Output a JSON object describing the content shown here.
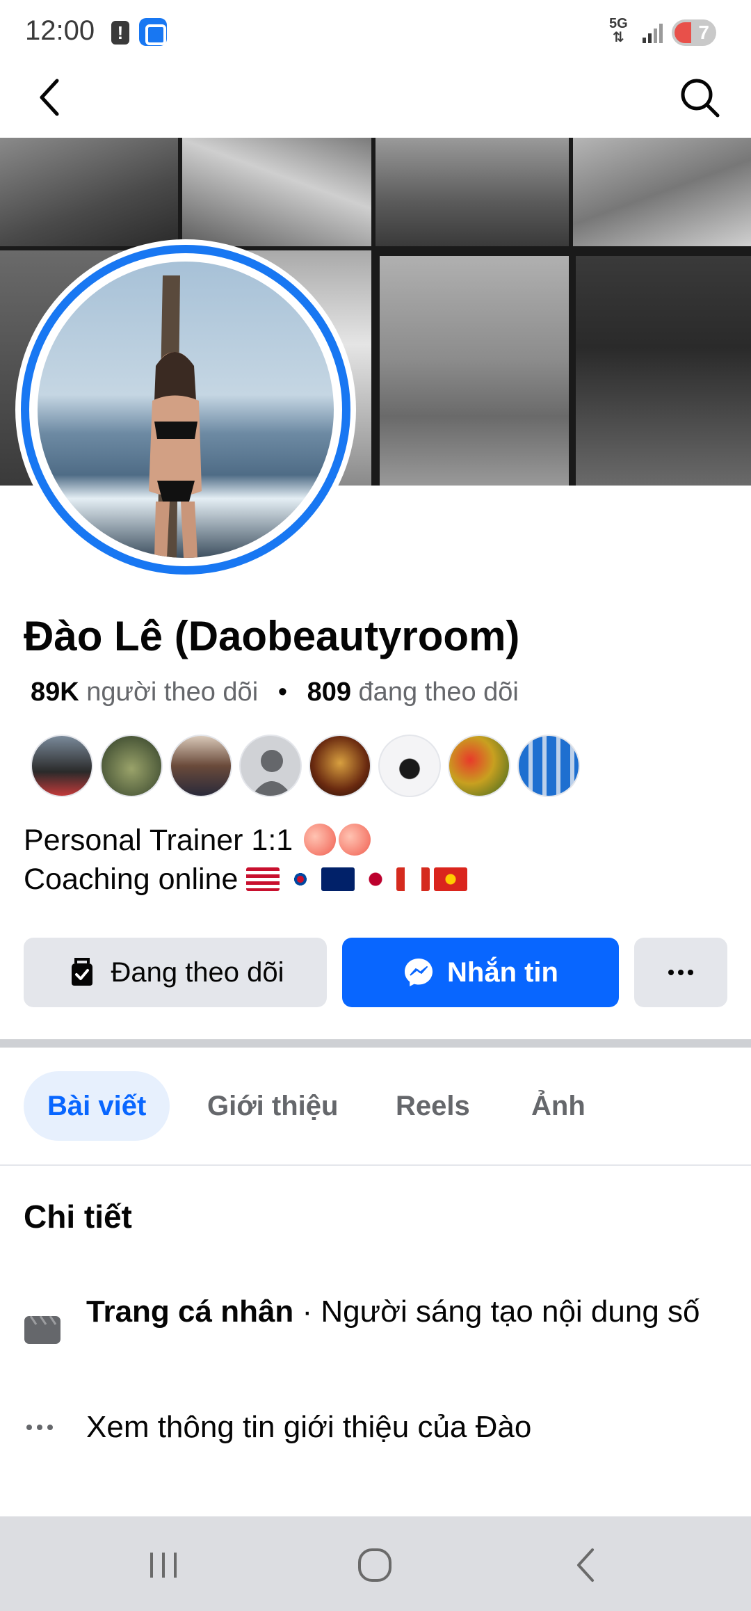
{
  "status_bar": {
    "time": "12:00",
    "network": "5G",
    "battery": "7"
  },
  "nav": {
    "back_icon": "chevron-left-icon",
    "search_icon": "search-icon"
  },
  "profile": {
    "name": "Đào Lê (Daobeautyroom)",
    "followers_count": "89K",
    "followers_label": "người theo dõi",
    "separator": "•",
    "following_count": "809",
    "following_label": "đang theo dõi",
    "bio_line1": "Personal Trainer 1:1",
    "bio_line2": "Coaching online"
  },
  "actions": {
    "following_label": "Đang theo dõi",
    "message_label": "Nhắn tin",
    "more_label": "..."
  },
  "tabs": [
    {
      "label": "Bài viết",
      "active": true
    },
    {
      "label": "Giới thiệu",
      "active": false
    },
    {
      "label": "Reels",
      "active": false
    },
    {
      "label": "Ảnh",
      "active": false
    }
  ],
  "details": {
    "title": "Chi tiết",
    "page_type_bold": "Trang cá nhân",
    "page_type_rest": " · Người sáng tạo nội dung số",
    "see_more": "Xem thông tin giới thiệu của Đào"
  },
  "colors": {
    "accent": "#0866ff",
    "avatar_ring": "#1877f2",
    "button_gray": "#e4e6eb",
    "secondary_text": "#65676b"
  }
}
